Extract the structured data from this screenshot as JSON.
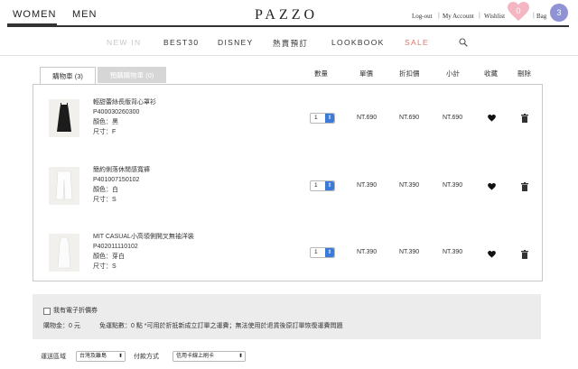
{
  "header": {
    "genders": [
      "WOMEN",
      "MEN"
    ],
    "logo": "PAZZO",
    "links": {
      "logout": "Log-out",
      "account": "My Account",
      "wishlist": "Wishlist",
      "bag": "Bag"
    },
    "wishlist_count": "0",
    "bag_count": "3"
  },
  "nav": [
    "NEW IN",
    "BEST30",
    "DISNEY",
    "熱賣預訂",
    "LOOKBOOK",
    "SALE"
  ],
  "tabs": [
    "購物車 (3)",
    "預購購物車 (0)"
  ],
  "columns": [
    "數量",
    "單價",
    "折扣價",
    "小計",
    "收藏",
    "刪除"
  ],
  "items": [
    {
      "name": "輕甜蕾絲長版背心罩衫",
      "sku": "P400030260300",
      "color": "顏色：黑",
      "size": "尺寸：F",
      "qty": "1",
      "price": "NT.690",
      "discount": "NT.690",
      "subtotal": "NT.690"
    },
    {
      "name": "簡約俐落休閒感寬褲",
      "sku": "P401007150102",
      "color": "顏色：白",
      "size": "尺寸：S",
      "qty": "1",
      "price": "NT.390",
      "discount": "NT.390",
      "subtotal": "NT.390"
    },
    {
      "name": "MIT CASUAL小高領側開叉無袖洋裝",
      "sku": "P402011110102",
      "color": "顏色：芽白",
      "size": "尺寸：S",
      "qty": "1",
      "price": "NT.390",
      "discount": "NT.390",
      "subtotal": "NT.390"
    }
  ],
  "coupon": {
    "checkbox_label": "我有電子折價券",
    "shopping_credit": "購物金：0 元",
    "shipping_points": "免運點數：0 點 *可用於折抵新成立訂單之運費；無法使用於退貨後原訂單恢復運費問題"
  },
  "delivery": {
    "region_label": "運送區域",
    "region_value": "台灣及離島",
    "payment_label": "付款方式",
    "payment_value": "信用卡線上刷卡"
  },
  "colors": {
    "badge_wishlist": "#f4b6c2",
    "badge_bag": "#8f93d6",
    "sale": "#d9776a",
    "qty_btn": "#3a7ad8"
  }
}
